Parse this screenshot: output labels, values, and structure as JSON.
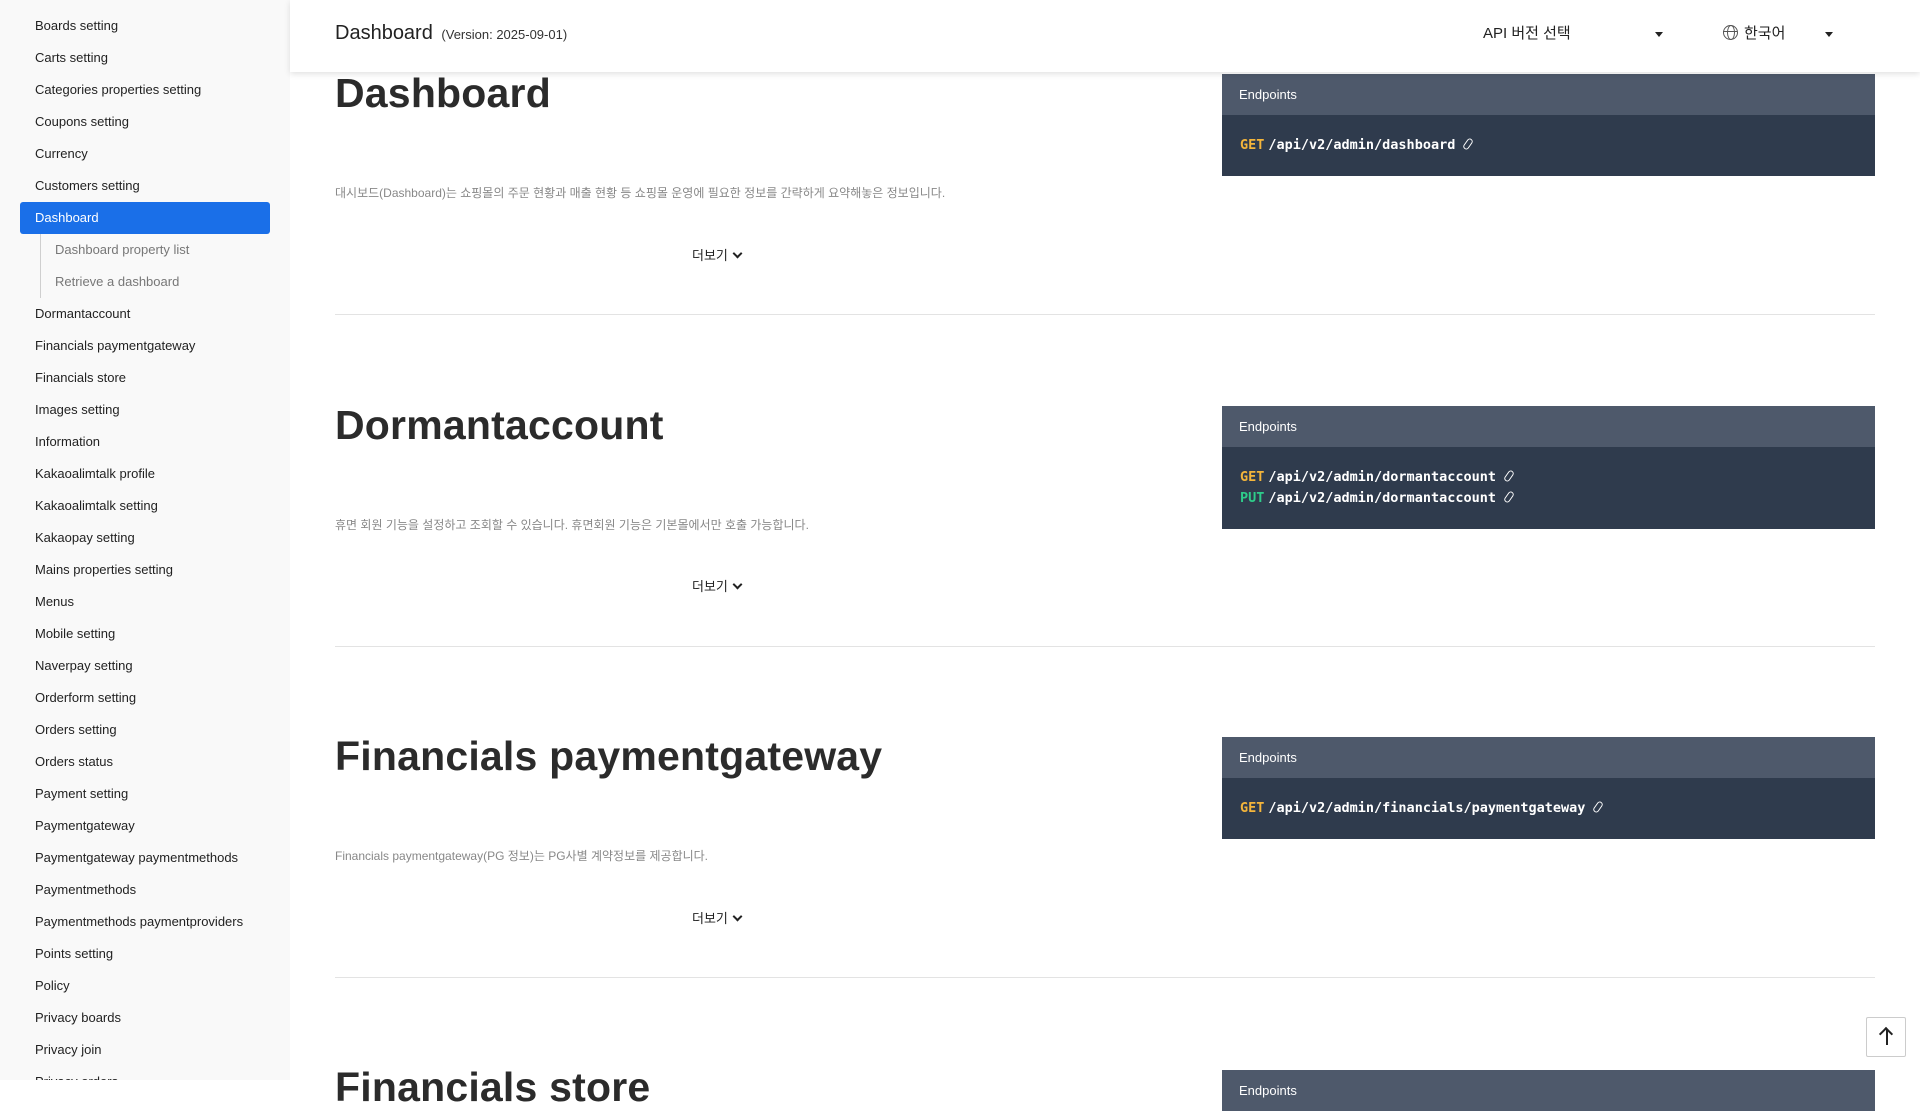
{
  "header": {
    "title": "Dashboard",
    "version": "(Version: 2025-09-01)",
    "api_select_label": "API 버전 선택",
    "language_label": "한국어"
  },
  "sidebar": {
    "items": [
      "Boards setting",
      "Carts setting",
      "Categories properties setting",
      "Coupons setting",
      "Currency",
      "Customers setting",
      "Dashboard",
      "Dormantaccount",
      "Financials paymentgateway",
      "Financials store",
      "Images setting",
      "Information",
      "Kakaoalimtalk profile",
      "Kakaoalimtalk setting",
      "Kakaopay setting",
      "Mains properties setting",
      "Menus",
      "Mobile setting",
      "Naverpay setting",
      "Orderform setting",
      "Orders setting",
      "Orders status",
      "Payment setting",
      "Paymentgateway",
      "Paymentgateway paymentmethods",
      "Paymentmethods",
      "Paymentmethods paymentproviders",
      "Points setting",
      "Policy",
      "Privacy boards",
      "Privacy join",
      "Privacy orders"
    ],
    "active_item": "Dashboard",
    "sub_items": [
      "Dashboard property list",
      "Retrieve a dashboard"
    ]
  },
  "sections": [
    {
      "title": "Dashboard",
      "description": "대시보드(Dashboard)는 쇼핑몰의 주문 현황과 매출 현황 등 쇼핑몰 운영에 필요한 정보를 간략하게 요약해놓은 정보입니다.",
      "more_label": "더보기",
      "endpoints_label": "Endpoints",
      "endpoints": [
        {
          "method": "GET",
          "path": "/api/v2/admin/dashboard"
        }
      ]
    },
    {
      "title": "Dormantaccount",
      "description": "휴면 회원 기능을 설정하고 조회할 수 있습니다. 휴면회원 기능은 기본몰에서만 호출 가능합니다.",
      "more_label": "더보기",
      "endpoints_label": "Endpoints",
      "endpoints": [
        {
          "method": "GET",
          "path": "/api/v2/admin/dormantaccount"
        },
        {
          "method": "PUT",
          "path": "/api/v2/admin/dormantaccount"
        }
      ]
    },
    {
      "title": "Financials paymentgateway",
      "description": "Financials paymentgateway(PG 정보)는 PG사별 계약정보를 제공합니다.",
      "more_label": "더보기",
      "endpoints_label": "Endpoints",
      "endpoints": [
        {
          "method": "GET",
          "path": "/api/v2/admin/financials/paymentgateway"
        }
      ]
    },
    {
      "title": "Financials store",
      "endpoints_label": "Endpoints"
    }
  ],
  "colors": {
    "accent": "#1a6fe8",
    "get": "#f4b53b",
    "put": "#2ecc8a",
    "endpoint_bg": "#2f3b4d",
    "endpoint_header": "#4e596b"
  }
}
